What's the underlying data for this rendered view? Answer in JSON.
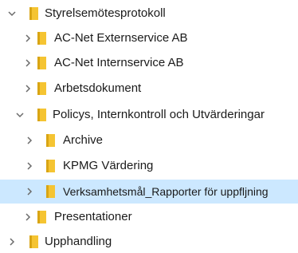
{
  "tree": {
    "items": [
      {
        "label": "Styrelsemötesprotokoll",
        "icon": "folder-icon",
        "chevron": "chevron-down-icon",
        "expanded": true,
        "selected": false
      },
      {
        "label": "AC-Net Externservice AB",
        "icon": "folder-icon",
        "chevron": "chevron-right-icon",
        "expanded": false,
        "selected": false
      },
      {
        "label": "AC-Net Internservice AB",
        "icon": "folder-icon",
        "chevron": "chevron-right-icon",
        "expanded": false,
        "selected": false
      },
      {
        "label": "Arbetsdokument",
        "icon": "folder-icon",
        "chevron": "chevron-right-icon",
        "expanded": false,
        "selected": false
      },
      {
        "label": "Policys, Internkontroll och Utvärderingar",
        "icon": "folder-icon",
        "chevron": "chevron-down-icon",
        "expanded": true,
        "selected": false
      },
      {
        "label": "Archive",
        "icon": "folder-icon",
        "chevron": "chevron-right-icon",
        "expanded": false,
        "selected": false
      },
      {
        "label": "KPMG Värdering",
        "icon": "folder-icon",
        "chevron": "chevron-right-icon",
        "expanded": false,
        "selected": false
      },
      {
        "label": "Verksamhetsmål_Rapporter för uppfljning",
        "icon": "folder-icon",
        "chevron": "chevron-right-icon",
        "expanded": false,
        "selected": true
      },
      {
        "label": "Presentationer",
        "icon": "folder-icon",
        "chevron": "chevron-right-icon",
        "expanded": false,
        "selected": false
      },
      {
        "label": "Upphandling",
        "icon": "folder-icon",
        "chevron": "chevron-right-icon",
        "expanded": false,
        "selected": false
      }
    ]
  },
  "colors": {
    "folder": "#f5c432",
    "folder_dark": "#d9a514",
    "chevron": "#6b6b6b",
    "selection": "#cce8ff",
    "text": "#1a1a1a"
  }
}
